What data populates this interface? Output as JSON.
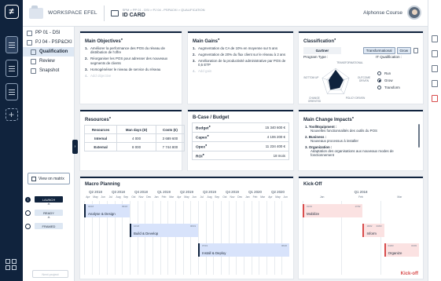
{
  "header": {
    "workspace": "WORKSPACE EFEL",
    "breadcrumb": "SPM > PP 01 - DSI > PJ 04 - PSP&CKI > QUALIFICATION",
    "page_title": "ID CARD",
    "user_name": "Alphonse Course"
  },
  "sidebar": {
    "items": [
      {
        "label": "PP 01 - DSI"
      },
      {
        "label": "PJ 04 - PSP&CKI"
      },
      {
        "label": "Qualification"
      },
      {
        "label": "Review"
      },
      {
        "label": "Snapshot"
      }
    ],
    "view_matrix": "View on matrix",
    "stages": [
      "LAUNCH",
      "READY",
      "FRAMED"
    ],
    "next_project": "Next project"
  },
  "objectives": {
    "title": "Main Objectives",
    "items": [
      {
        "n": "1.",
        "text": "Améliorer la performance des POS du réseau de distribution de l'offre"
      },
      {
        "n": "2.",
        "text": "Réorganiser les POS pour adresser des nouveaux segments de clients"
      },
      {
        "n": "3.",
        "text": "Homogénéiser le niveau de service du réseau"
      },
      {
        "n": "4.",
        "text": "Add objective"
      }
    ]
  },
  "gains": {
    "title": "Main Gains",
    "items": [
      {
        "n": "1.",
        "text": "Augmentation du CA de 10% en moyenne sur 5 ans"
      },
      {
        "n": "2.",
        "text": "Augmentation de 20% du flux client sur le réseau à 2 ans"
      },
      {
        "n": "3.",
        "text": "Amélioration de la productivité administrative par POS de 0,5 ETP"
      },
      {
        "n": "4.",
        "text": "Add gain"
      }
    ]
  },
  "classification": {
    "title": "Classification",
    "owner": "Gartner",
    "tags": [
      "Transformational",
      "Grow"
    ],
    "program_type_label": "Program Type :",
    "it_label": "IT Qualification :",
    "radar_labels": [
      "TRANSFORMATIONAL",
      "OUTCOME DRIVEN",
      "POLICY DRIVEN",
      "CHANGE ORIENTED",
      "BOTTOM UP"
    ],
    "radar_values": [
      0.85,
      0.55,
      0.45,
      0.6,
      0.5
    ],
    "it_options": [
      "Run",
      "Grow",
      "Transform"
    ],
    "it_selected": "Grow"
  },
  "resources": {
    "title": "Resources",
    "headers": [
      "Resources",
      "Man days (D)",
      "Costs (€)"
    ],
    "rows": [
      [
        "Internal",
        "4 000",
        "3 689 600"
      ],
      [
        "External",
        "8 000",
        "7 744 800"
      ]
    ]
  },
  "bcase": {
    "title": "B-Case / Budget",
    "rows": [
      {
        "label": "Budget",
        "value": "15 340 600 €"
      },
      {
        "label": "Capex",
        "value": "4 106 200 €"
      },
      {
        "label": "Opex",
        "value": "11 234 400 €"
      },
      {
        "label": "ROI",
        "value": "18 mois"
      }
    ]
  },
  "change": {
    "title": "Main Change Impacts",
    "items": [
      {
        "head": "1. Tool/Equipment :",
        "desc": "Nouvelles fonctionnalités des outils du POS"
      },
      {
        "head": "2. Business :",
        "desc": "Nouveaux processus à installer"
      },
      {
        "head": "3. Organization :",
        "desc": "Adaptation des organisations aux nouveaux modes de fonctionnement"
      }
    ]
  },
  "macro": {
    "title": "Macro Planning",
    "quarters": [
      "Q2 2018",
      "Q3 2018",
      "Q4 2018",
      "Q1 2019",
      "Q2 2019",
      "Q3 2019",
      "Q4 2019",
      "Q1 2020",
      "Q2 2020"
    ],
    "months": [
      "Apr",
      "May",
      "Jun",
      "Jul",
      "Aug",
      "Sep",
      "Oct",
      "Nov",
      "Dec",
      "Jan",
      "Feb",
      "Mar",
      "Apr",
      "May",
      "Jun",
      "Jul",
      "Aug",
      "Sep",
      "Oct",
      "Nov",
      "Dec",
      "Jan",
      "Feb",
      "Mar",
      "Apr",
      "May",
      "Jun"
    ],
    "tasks": [
      {
        "name": "Analyse & Design",
        "start": "04/18",
        "end": "09/18",
        "s": 0,
        "e": 6,
        "row": 0
      },
      {
        "name": "Build & Develop",
        "start": "10/18",
        "end": "06/19",
        "s": 6,
        "e": 15,
        "row": 1
      },
      {
        "name": "Install & Deploy",
        "start": "07/19",
        "end": "06/20",
        "s": 15,
        "e": 27,
        "row": 2
      }
    ]
  },
  "kickoff": {
    "title": "Kick-Off",
    "quarter": "Q1 2018",
    "months": [
      "Jan",
      "Feb",
      "Mar"
    ],
    "tasks": [
      {
        "name": "Mobilize",
        "start": "01/01",
        "end": "17/02",
        "s": 0,
        "e": 1.55,
        "row": 0
      },
      {
        "name": "Inform",
        "start": "18/02",
        "end": "03/03",
        "s": 1.55,
        "e": 2.1,
        "row": 1
      },
      {
        "name": "Organize",
        "start": "04/03",
        "end": "31/03",
        "s": 2.1,
        "e": 3,
        "row": 2
      }
    ],
    "watermark": "Kick-off"
  },
  "colors": {
    "navy": "#10233d",
    "plan_bar": "#d8e3fb",
    "kick_bar": "#fbe2e2",
    "accent_red": "#d84c4c"
  }
}
